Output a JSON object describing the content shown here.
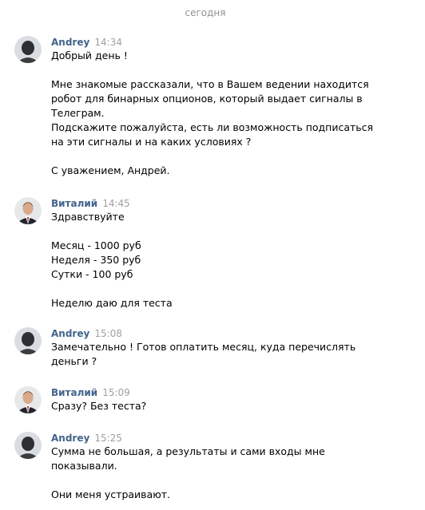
{
  "date_separator": "сегодня",
  "colors": {
    "author": "#42648b",
    "time": "#a0a0a0",
    "separator": "#939393",
    "text": "#000000"
  },
  "messages": [
    {
      "author": "Andrey",
      "time": "14:34",
      "avatar_icon": "person-dark-avatar",
      "lines": [
        "Добрый день !",
        "",
        "Мне знакомые рассказали, что в Вашем ведении находится",
        "робот для бинарных опционов, который выдает сигналы в",
        "Телеграм.",
        "Подскажите пожалуйста, есть ли возможность подписаться",
        "на эти сигналы и на каких условиях ?",
        "",
        "С уважением, Андрей."
      ]
    },
    {
      "author": "Виталий",
      "time": "14:45",
      "avatar_icon": "person-suit-avatar",
      "lines": [
        "Здравствуйте",
        "",
        "Месяц - 1000 руб",
        "Неделя - 350 руб",
        "Сутки - 100 руб",
        "",
        "Неделю даю для теста"
      ]
    },
    {
      "author": "Andrey",
      "time": "15:08",
      "avatar_icon": "person-dark-avatar",
      "lines": [
        "Замечательно ! Готов оплатить месяц, куда перечислять",
        "деньги ?"
      ]
    },
    {
      "author": "Виталий",
      "time": "15:09",
      "avatar_icon": "person-suit-avatar",
      "lines": [
        "Сразу? Без теста?"
      ]
    },
    {
      "author": "Andrey",
      "time": "15:25",
      "avatar_icon": "person-dark-avatar",
      "lines": [
        "Сумма не большая, а результаты и сами входы мне",
        "показывали.",
        "",
        "Они меня устраивают."
      ]
    }
  ]
}
